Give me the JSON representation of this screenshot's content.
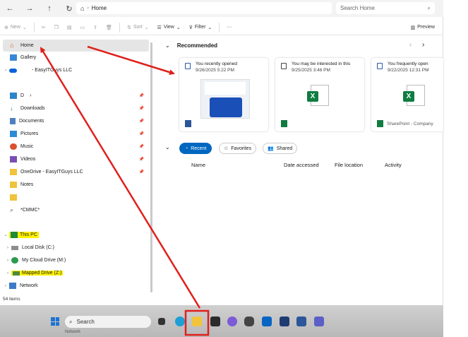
{
  "address": {
    "home_label": "Home"
  },
  "search": {
    "placeholder": "Search Home"
  },
  "toolbar": {
    "new": "New",
    "sort": "Sort",
    "view": "View",
    "filter": "Filter",
    "more": "···",
    "preview": "Preview"
  },
  "sidebar": {
    "home": "Home",
    "gallery": "Gallery",
    "onedrive": "- EasyITGuys LLC",
    "desktop": "D",
    "downloads": "Downloads",
    "documents": "Documents",
    "pictures": "Pictures",
    "music": "Music",
    "videos": "Videos",
    "onedrive_folder": "OneDrive - EasyITGuys LLC",
    "notes": "Notes",
    "cmmc": "*CMMC*",
    "this_pc": "This PC",
    "local_disk": "Local Disk (C:)",
    "cloud_drive": "My Cloud Drive (M:)",
    "mapped_drive": "Mapped Drive (Z:)",
    "network": "Network"
  },
  "main": {
    "recommended": "Recommended",
    "cards": [
      {
        "title": "You recently opened",
        "date": "9/26/2025 5:22 PM"
      },
      {
        "title": "You may be interested in this",
        "date": "9/25/2025 3:46 PM"
      },
      {
        "title": "You frequently open",
        "date": "9/22/2025 12:31 PM",
        "footer": "SharePoint - Company"
      }
    ],
    "tabs": {
      "recent": "Recent",
      "favorites": "Favorites",
      "shared": "Shared"
    },
    "columns": {
      "name": "Name",
      "date_accessed": "Date accessed",
      "file_location": "File location",
      "activity": "Activity"
    }
  },
  "status": {
    "items": "54 items"
  },
  "taskbar": {
    "search": "Search",
    "network_ghost": "Network"
  },
  "colors": {
    "accent": "#0067c0",
    "highlight": "#fff200",
    "arrow": "#e0201c",
    "excel": "#107c41"
  }
}
